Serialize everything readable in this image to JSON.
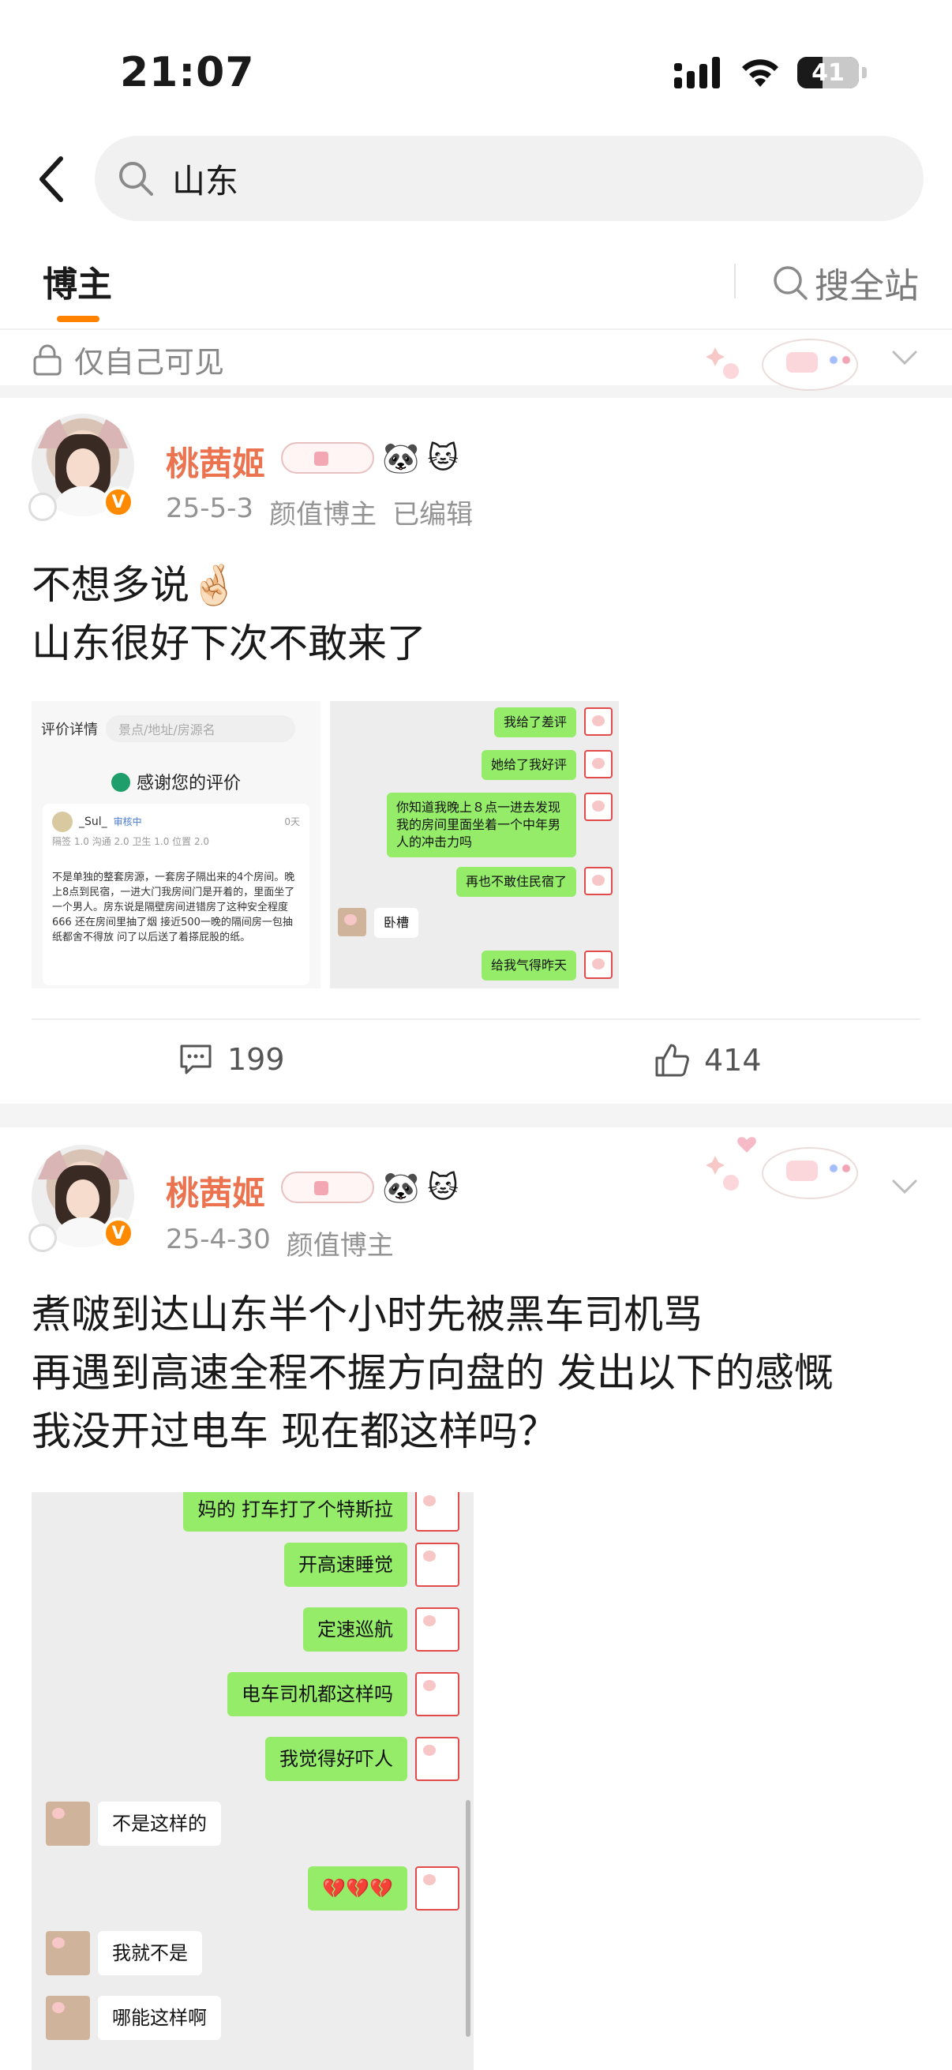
{
  "status_bar": {
    "time": "21:07",
    "battery": "41",
    "battery_level": 0.41
  },
  "search": {
    "query": "山东"
  },
  "tabs": {
    "active": "博主",
    "search_all": "搜全站"
  },
  "partial_post": {
    "visibility": "仅自己可见"
  },
  "posts": [
    {
      "author": "桃茜姬",
      "date": "25-5-3",
      "category": "颜值博主",
      "edited": "已编辑",
      "text": [
        "不想多说🤞🏻",
        "山东很好下次不敢来了"
      ],
      "review_image": {
        "back_label": "评价详情",
        "search_placeholder": "景点/地址/房源名",
        "thanks": "感谢您的评价",
        "user": "_Sul_",
        "status": "审核中",
        "date": "0天",
        "scores": "隔签 1.0 沟通 2.0 卫生 1.0 位置 2.0",
        "body": "不是单独的整套房源，一套房子隔出来的4个房间。晚上8点到民宿，一进大门我房间门是开着的，里面坐了一个男人。房东说是隔壁房间进错房了这种安全程度666 还在房间里抽了烟 接近500一晚的隔间房一包抽纸都舍不得放 问了以后送了着搽屁股的纸。"
      },
      "chat_image": {
        "messages": [
          {
            "side": "right",
            "text": "我给了差评"
          },
          {
            "side": "right",
            "text": "她给了我好评"
          },
          {
            "side": "right",
            "text": "你知道我晚上８点一进去发现我的房间里面坐着一个中年男人的冲击力吗"
          },
          {
            "side": "right",
            "text": "再也不敢住民宿了"
          },
          {
            "side": "left",
            "text": "卧槽"
          },
          {
            "side": "right",
            "text": "给我气得昨天"
          }
        ]
      },
      "comments": "199",
      "likes": "414"
    },
    {
      "author": "桃茜姬",
      "date": "25-4-30",
      "category": "颜值博主",
      "text": [
        "煮啵到达山东半个小时先被黑车司机骂",
        "再遇到高速全程不握方向盘的 发出以下的感慨",
        "我没开过电车 现在都这样吗？"
      ],
      "chat_image": {
        "messages": [
          {
            "side": "right",
            "text": "妈的 打车打了个特斯拉"
          },
          {
            "side": "right",
            "text": "开高速睡觉"
          },
          {
            "side": "right",
            "text": "定速巡航"
          },
          {
            "side": "right",
            "text": "电车司机都这样吗"
          },
          {
            "side": "right",
            "text": "我觉得好吓人"
          },
          {
            "side": "left",
            "text": "不是这样的"
          },
          {
            "side": "right",
            "text": "💔💔💔"
          },
          {
            "side": "left",
            "text": "我就不是"
          },
          {
            "side": "left",
            "text": "哪能这样啊"
          }
        ]
      }
    }
  ],
  "colors": {
    "accent": "#ff8200",
    "author": "#eb7350",
    "bubble_green": "#95ec69"
  }
}
